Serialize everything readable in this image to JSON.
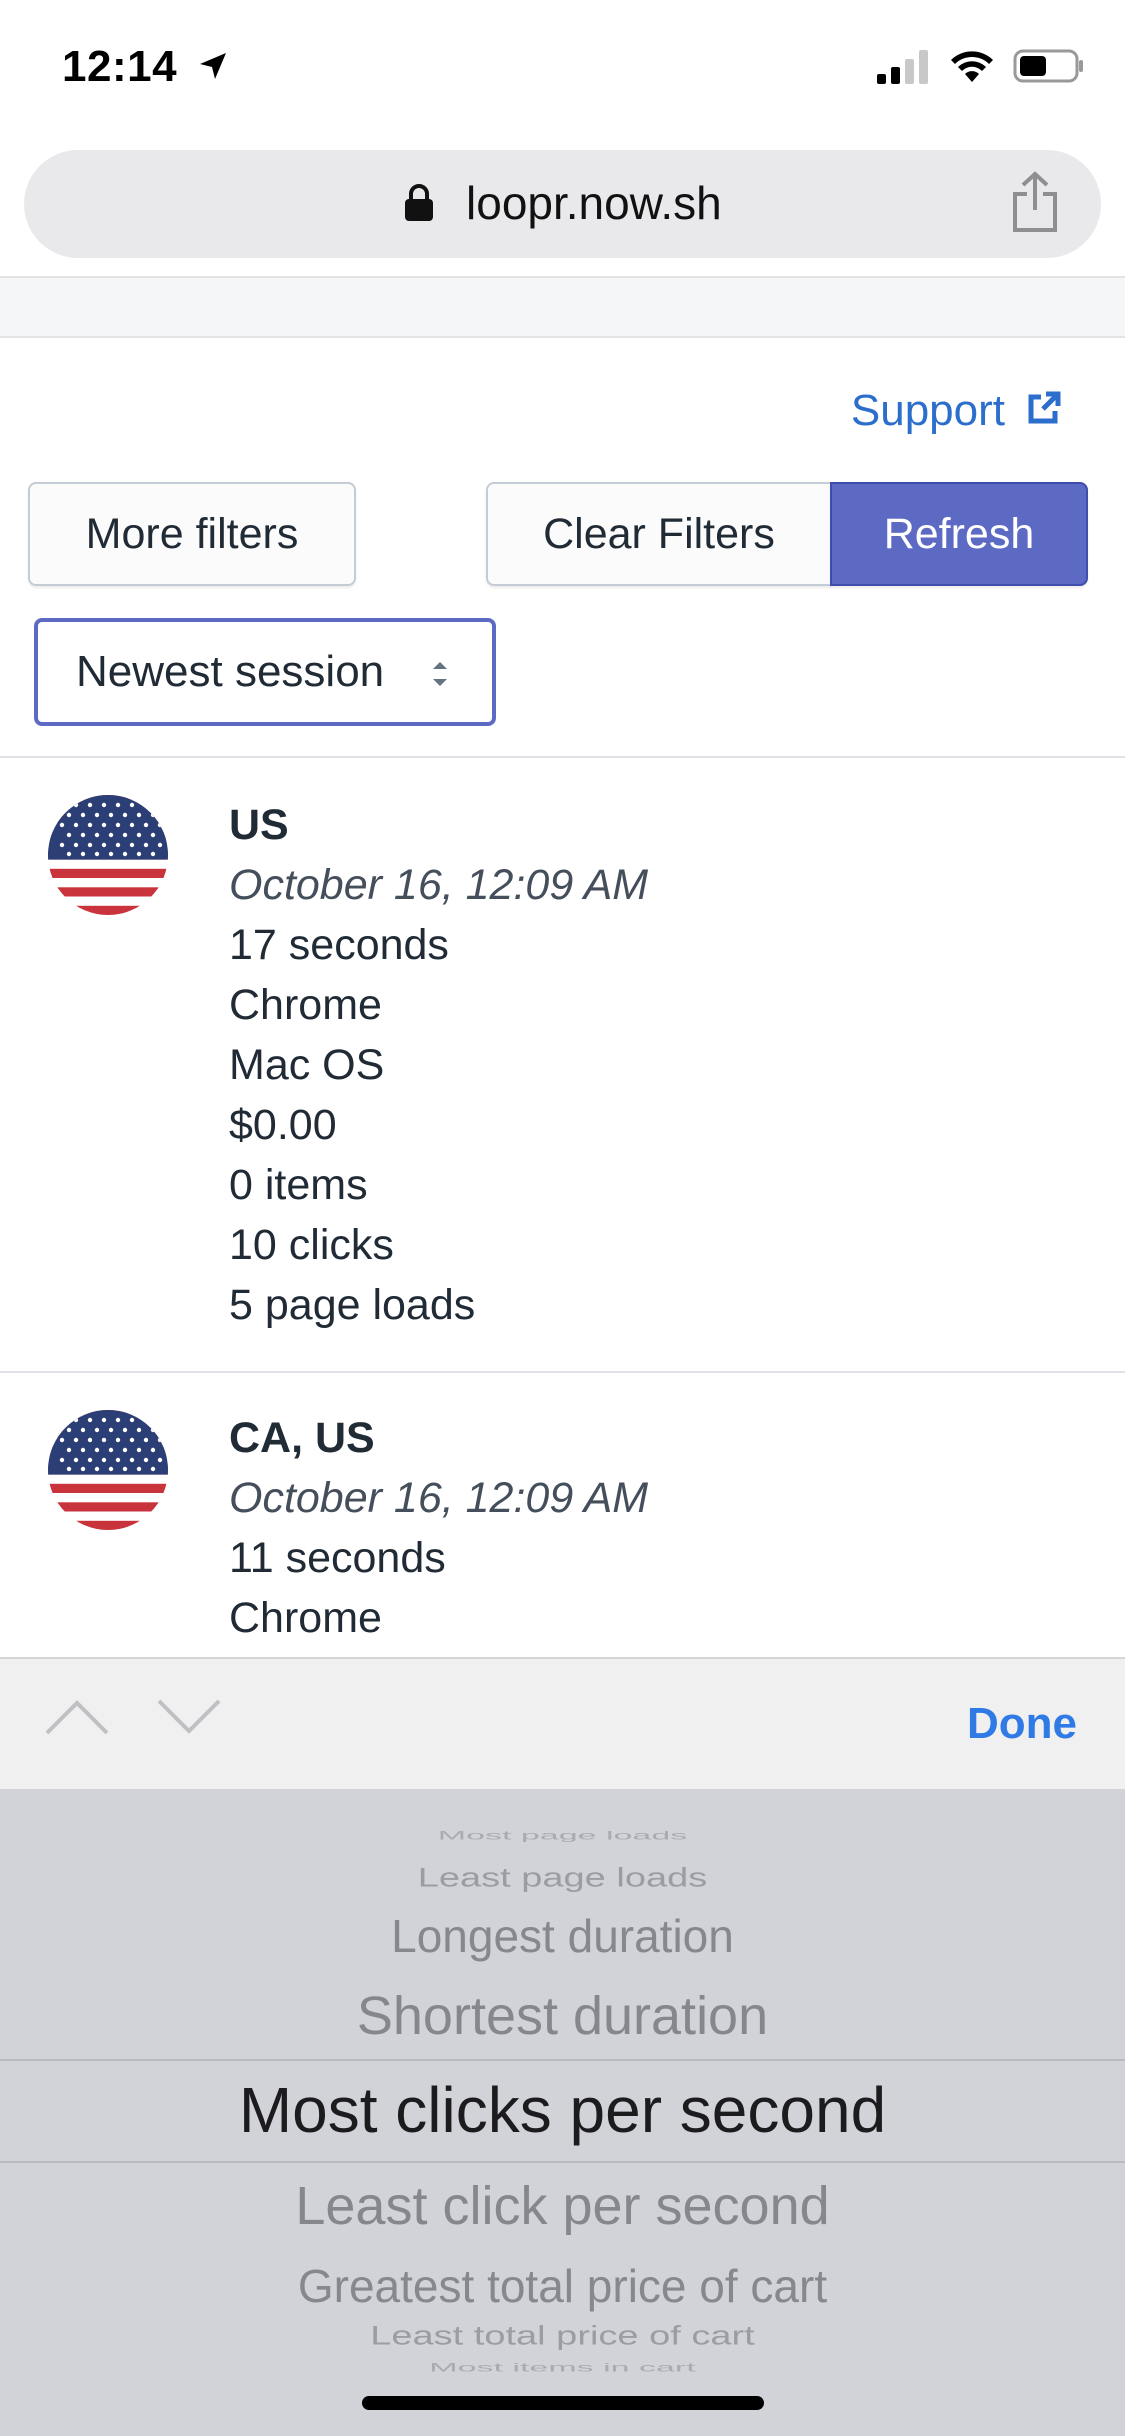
{
  "status_bar": {
    "time": "12:14"
  },
  "browser": {
    "url": "loopr.now.sh"
  },
  "header": {
    "support_label": "Support"
  },
  "filters": {
    "more_filters_label": "More filters",
    "clear_filters_label": "Clear Filters",
    "refresh_label": "Refresh"
  },
  "sort": {
    "selected": "Newest session"
  },
  "sessions": [
    {
      "location": "US",
      "date": "October 16, 12:09 AM",
      "duration": "17 seconds",
      "browser": "Chrome",
      "os": "Mac OS",
      "cart_total": "$0.00",
      "items": "0 items",
      "clicks": "10 clicks",
      "page_loads": "5 page loads"
    },
    {
      "location": "CA, US",
      "date": "October 16, 12:09 AM",
      "duration": "11 seconds",
      "browser": "Chrome"
    }
  ],
  "keyboard_accessory": {
    "done_label": "Done"
  },
  "picker": {
    "options": [
      "Most page loads",
      "Least page loads",
      "Longest duration",
      "Shortest duration",
      "Most clicks per second",
      "Least click per second",
      "Greatest total price of cart",
      "Least total price of cart",
      "Most items in cart"
    ],
    "selected": "Most clicks per second"
  },
  "colors": {
    "accent": "#5c6ac4",
    "link": "#2c6ecb",
    "done": "#2f7ae5"
  }
}
